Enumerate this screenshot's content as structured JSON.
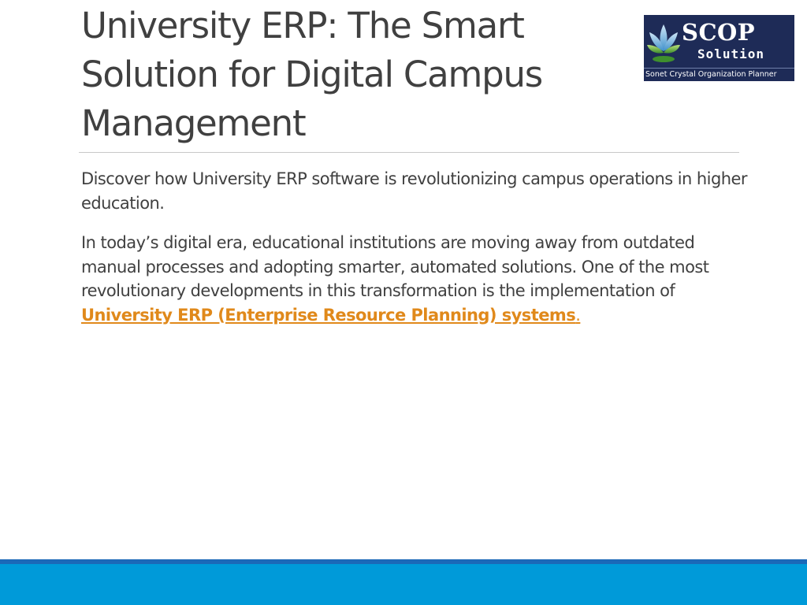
{
  "slide": {
    "title": "University ERP: The Smart Solution for Digital Campus Management",
    "intro": "Discover how University ERP software is revolutionizing campus operations in higher education.",
    "paragraph_lead": "In today’s digital era, educational institutions are moving away from outdated manual processes and adopting smarter, automated solutions. One of the most revolutionary developments in this transformation is the implementation of ",
    "link_text": "University ERP (Enterprise Resource Planning) systems",
    "link_trailing": "."
  },
  "logo": {
    "name": "SCOP",
    "subtitle": "Solution",
    "tagline": "Sonet Crystal Organization Planner",
    "icon": "lotus-icon"
  },
  "colors": {
    "text": "#404040",
    "link": "#e0891b",
    "footer_dark": "#1b69b8",
    "footer_light": "#009ad9",
    "logo_background": "#1e2b57"
  }
}
